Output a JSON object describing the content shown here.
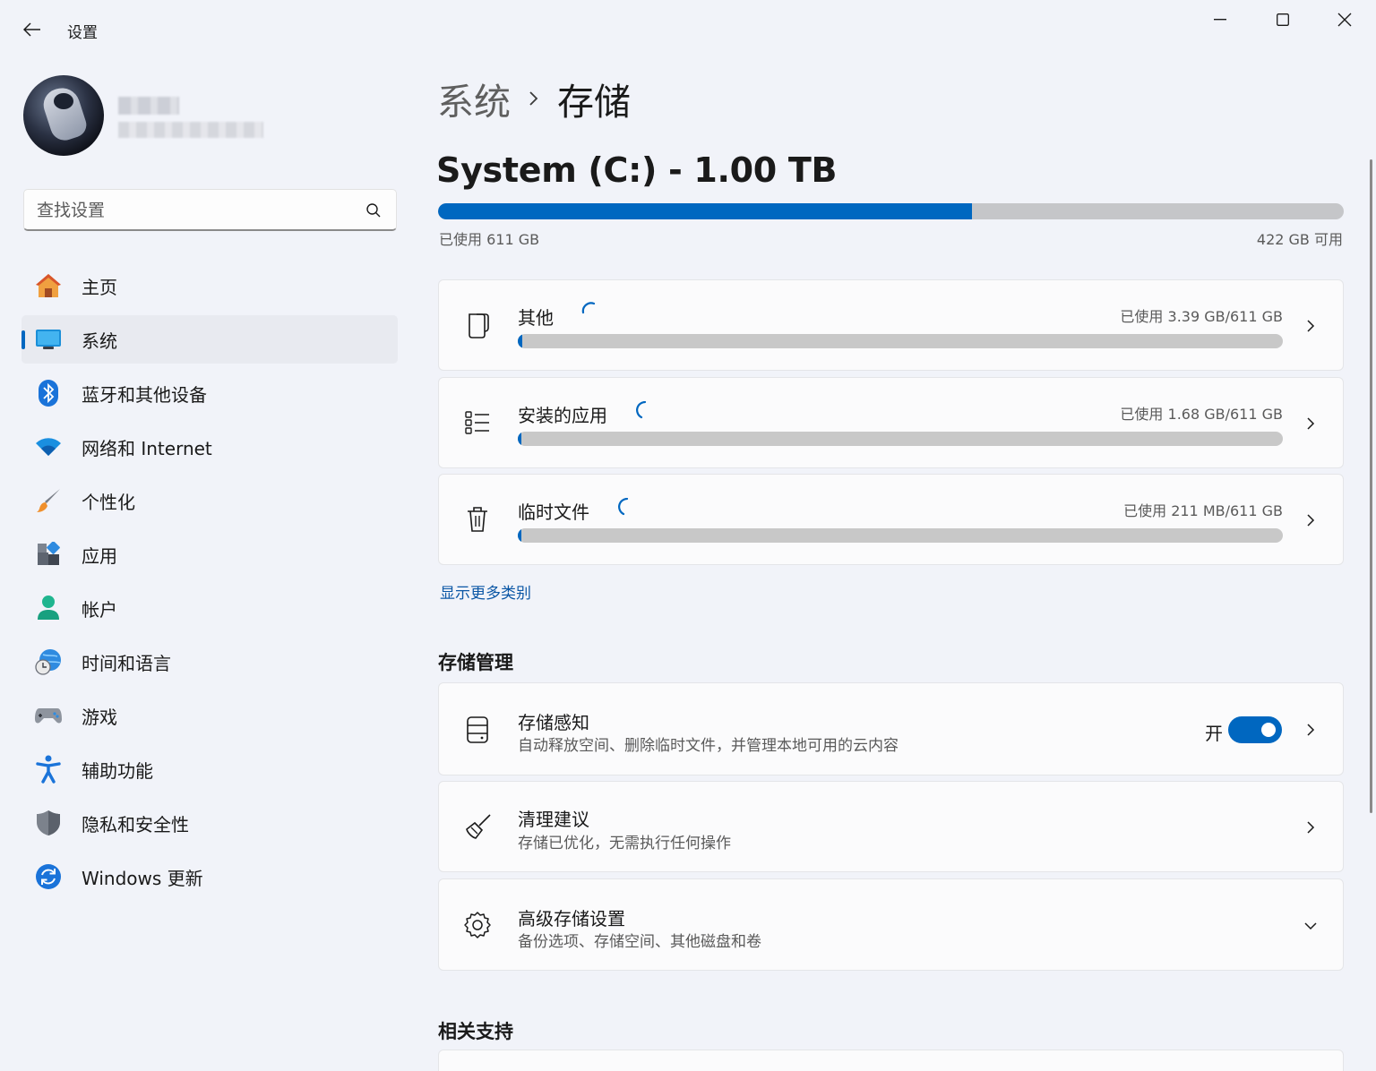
{
  "window": {
    "title": "设置",
    "controls": {
      "minimize_icon": "minimize-icon",
      "maximize_icon": "maximize-icon",
      "close_icon": "close-icon"
    }
  },
  "search": {
    "placeholder": "查找设置"
  },
  "sidebar": {
    "items": [
      {
        "label": "主页",
        "icon": "home-icon",
        "active": false
      },
      {
        "label": "系统",
        "icon": "system-display-icon",
        "active": true
      },
      {
        "label": "蓝牙和其他设备",
        "icon": "bluetooth-icon",
        "active": false
      },
      {
        "label": "网络和 Internet",
        "icon": "wifi-icon",
        "active": false
      },
      {
        "label": "个性化",
        "icon": "paintbrush-icon",
        "active": false
      },
      {
        "label": "应用",
        "icon": "apps-icon",
        "active": false
      },
      {
        "label": "帐户",
        "icon": "account-icon",
        "active": false
      },
      {
        "label": "时间和语言",
        "icon": "time-language-icon",
        "active": false
      },
      {
        "label": "游戏",
        "icon": "gamepad-icon",
        "active": false
      },
      {
        "label": "辅助功能",
        "icon": "accessibility-icon",
        "active": false
      },
      {
        "label": "隐私和安全性",
        "icon": "shield-icon",
        "active": false
      },
      {
        "label": "Windows 更新",
        "icon": "windows-update-icon",
        "active": false
      }
    ]
  },
  "breadcrumb": {
    "parent": "系统",
    "current": "存储"
  },
  "drive": {
    "title": "System (C:) - 1.00 TB",
    "used_label": "已使用 611 GB",
    "free_label": "422 GB 可用",
    "used_fraction": 0.59,
    "accent": "#0067c0"
  },
  "categories": [
    {
      "title": "其他",
      "used": "已使用 3.39 GB/611 GB",
      "fraction": 0.0055,
      "icon": "document-icon"
    },
    {
      "title": "安装的应用",
      "used": "已使用 1.68 GB/611 GB",
      "fraction": 0.0027,
      "icon": "list-icon"
    },
    {
      "title": "临时文件",
      "used": "已使用 211 MB/611 GB",
      "fraction": 0.0003,
      "icon": "trash-icon"
    }
  ],
  "show_more": "显示更多类别",
  "storage_management": {
    "heading": "存储管理",
    "items": [
      {
        "title": "存储感知",
        "desc": "自动释放空间、删除临时文件，并管理本地可用的云内容",
        "toggle_label": "开",
        "toggle_on": true,
        "icon": "storage-sense-icon"
      },
      {
        "title": "清理建议",
        "desc": "存储已优化，无需执行任何操作",
        "icon": "broom-icon"
      },
      {
        "title": "高级存储设置",
        "desc": "备份选项、存储空间、其他磁盘和卷",
        "icon": "gear-icon"
      }
    ]
  },
  "related_support": {
    "heading": "相关支持"
  }
}
